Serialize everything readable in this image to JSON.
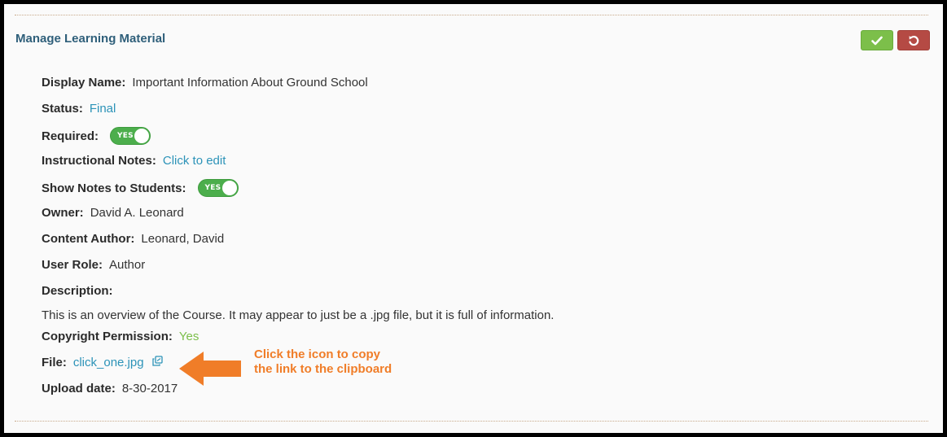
{
  "panel": {
    "title": "Manage Learning Material",
    "save_icon": "check-icon",
    "cancel_icon": "undo-icon"
  },
  "fields": {
    "display_name": {
      "label": "Display Name:",
      "value": "Important Information About Ground School"
    },
    "status": {
      "label": "Status:",
      "value": "Final"
    },
    "required": {
      "label": "Required:",
      "toggle": "YES"
    },
    "instructional_notes": {
      "label": "Instructional Notes:",
      "value": "Click to edit"
    },
    "show_notes": {
      "label": "Show Notes to Students:",
      "toggle": "YES"
    },
    "owner": {
      "label": "Owner:",
      "value": "David A. Leonard"
    },
    "content_author": {
      "label": "Content Author:",
      "value": "Leonard, David"
    },
    "user_role": {
      "label": "User Role:",
      "value": "Author"
    },
    "description": {
      "label": "Description:",
      "value": "This is an overview of the Course. It may appear to just be a .jpg file, but it is full of information."
    },
    "copyright": {
      "label": "Copyright Permission:",
      "value": "Yes"
    },
    "file": {
      "label": "File:",
      "value": "click_one.jpg",
      "icon": "copy-icon"
    },
    "upload_date": {
      "label": "Upload date:",
      "value": "8-30-2017"
    }
  },
  "callout": {
    "text": "Click the icon to copy the link to the clipboard",
    "color": "#f07d28"
  },
  "colors": {
    "title": "#2f5f7a",
    "link": "#2c93b8",
    "save_button": "#7cbf4a",
    "cancel_button": "#b54a44",
    "toggle_on": "#4cae4c"
  }
}
